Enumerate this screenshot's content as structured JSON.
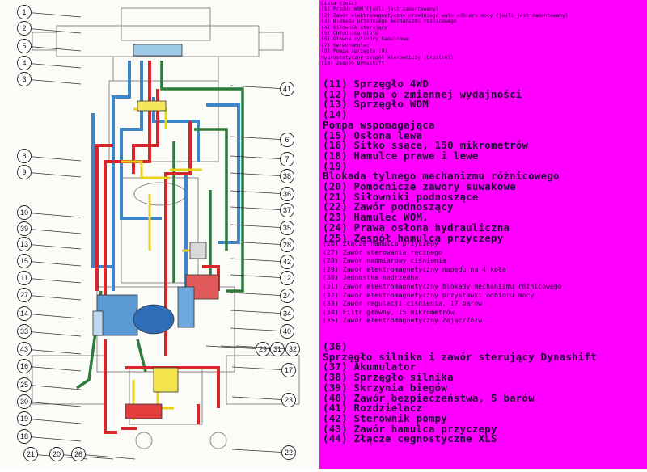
{
  "legend": {
    "small_items": [
      "Lista części",
      "(1) Przód: WOM (jeśli jest zamontowany)",
      "(2) Zawór elektromagnetyczny przedniego wału odbioru mocy (jeśli jest zamontowany)",
      "(3) Blokada przedniego mechanizmu różnicowego",
      "(4) Siłownik sterujący",
      "(5) Chłodnica oleju",
      "(6) Główne cylindry hamulcowe",
      "(7) Serwohamulec",
      "(8) Pompa sprzęgła (9)",
      "Hydrostatyczny zespół kierowniczy (Orbitrol)",
      "(10) Zespół Dynashift"
    ],
    "big_items_a": [
      "(11) Sprzęgło 4WD",
      "(12) Pompa o zmiennej wydajności",
      "(13) Sprzęgło WOM",
      "(14)",
      "Pompa wspomagająca",
      "(15) Osłona lewa",
      "(16) Sitko ssące, 150 mikrometrów",
      "(18) Hamulce prawe i lewe",
      "(19)",
      "Blokada tylnego mechanizmu różnicowego",
      "(20) Pomocnicze zawory suwakowe",
      "(21) Siłowniki podnoszące",
      "(22) Zawór podnoszący",
      "(23) Hamulec WOM.",
      "(24) Prawa osłona hydrauliczna",
      "(25) Zespół hamulca przyczepy"
    ],
    "mid_items": [
      "(26) Złącze hamulca przyczepy",
      "(27) Zawór sterowania ręcznego",
      "(28) Zawór nadmiarowy ciśnienia",
      "(29) Zawór elektromagnetyczny napędu na 4 koła",
      "(30) Jednostka nadrzędna",
      "(31) Zawór elektromagnetyczny blokady mechanizmu różnicowego",
      "(32) Zawór elektromagnetyczny przystawki odbioru mocy",
      "(33) Zawór regulacji ciśnienia, 17 barów",
      "(34) Filtr główny, 15 mikrometrów",
      "(35) Zawór elektromagnetyczny Zając/Żółw"
    ],
    "big_items_b": [
      "(36)",
      "Sprzęgło silnika i zawór sterujący Dynashift",
      "(37) Akumulator",
      "(38) Sprzęgło silnika",
      "(39) Skrzynia biegów",
      "(40) Zawór bezpieczeństwa, 5 barów",
      "(41) Rozdzielacz",
      "(42) Sterownik pompy",
      "(43) Zawór hamulca przyczepy",
      "(44) Złącze cegnostyczne XLS"
    ]
  },
  "callouts_left": [
    {
      "n": "1"
    },
    {
      "n": "2"
    },
    {
      "n": "5"
    },
    {
      "n": "4"
    },
    {
      "n": "3"
    },
    {
      "n": "8"
    },
    {
      "n": "9"
    },
    {
      "n": "10"
    },
    {
      "n": "39"
    },
    {
      "n": "13"
    },
    {
      "n": "15"
    },
    {
      "n": "11"
    },
    {
      "n": "27"
    },
    {
      "n": "14"
    },
    {
      "n": "33"
    },
    {
      "n": "43"
    },
    {
      "n": "16"
    },
    {
      "n": "25"
    },
    {
      "n": "30"
    },
    {
      "n": "19"
    },
    {
      "n": "18"
    },
    {
      "n": "21"
    },
    {
      "n": "20"
    },
    {
      "n": "26"
    }
  ],
  "callouts_right": [
    {
      "n": "41"
    },
    {
      "n": "6"
    },
    {
      "n": "7"
    },
    {
      "n": "38"
    },
    {
      "n": "36"
    },
    {
      "n": "37"
    },
    {
      "n": "35"
    },
    {
      "n": "28"
    },
    {
      "n": "42"
    },
    {
      "n": "12"
    },
    {
      "n": "24"
    },
    {
      "n": "34"
    },
    {
      "n": "40"
    },
    {
      "n": "29"
    },
    {
      "n": "31"
    },
    {
      "n": "32"
    },
    {
      "n": "17"
    },
    {
      "n": "23"
    },
    {
      "n": "22"
    }
  ],
  "colors": {
    "legend_bg": "#ff00ff",
    "line_red": "#d8262c",
    "line_blue": "#3f86c8",
    "line_green": "#2d7a3a",
    "line_yellow": "#e8d21c"
  }
}
